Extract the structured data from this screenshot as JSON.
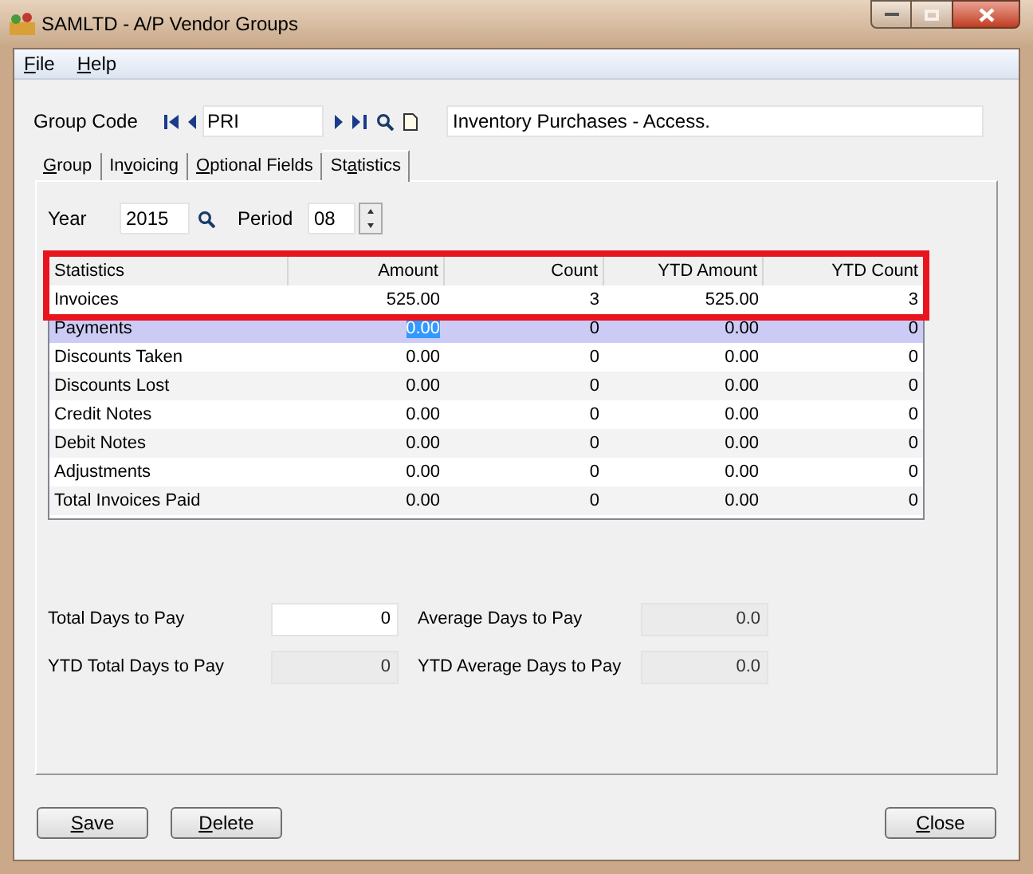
{
  "window": {
    "title": "SAMLTD - A/P Vendor Groups"
  },
  "menu": [
    {
      "key": "F",
      "after": "ile"
    },
    {
      "key": "H",
      "after": "elp"
    }
  ],
  "group_code": {
    "label": "Group Code",
    "value": "PRI",
    "description": "Inventory Purchases - Access."
  },
  "tabs": [
    {
      "key": "G",
      "after": "roup",
      "selected": false
    },
    {
      "before": "In",
      "key": "v",
      "after": "oicing",
      "selected": false
    },
    {
      "key": "O",
      "after": "ptional Fields",
      "selected": false
    },
    {
      "before": "St",
      "key": "a",
      "after": "tistics",
      "selected": true
    }
  ],
  "year": {
    "label": "Year",
    "value": "2015"
  },
  "period": {
    "label": "Period",
    "value": "08"
  },
  "table": {
    "columns": [
      "Statistics",
      "Amount",
      "Count",
      "YTD Amount",
      "YTD Count"
    ],
    "rows": [
      {
        "cells": [
          "Invoices",
          "525.00",
          "3",
          "525.00",
          "3"
        ],
        "selected": false
      },
      {
        "cells": [
          "Payments",
          "0.00",
          "0",
          "0.00",
          "0"
        ],
        "selected": true
      },
      {
        "cells": [
          "Discounts Taken",
          "0.00",
          "0",
          "0.00",
          "0"
        ],
        "selected": false
      },
      {
        "cells": [
          "Discounts Lost",
          "0.00",
          "0",
          "0.00",
          "0"
        ],
        "selected": false
      },
      {
        "cells": [
          "Credit Notes",
          "0.00",
          "0",
          "0.00",
          "0"
        ],
        "selected": false
      },
      {
        "cells": [
          "Debit Notes",
          "0.00",
          "0",
          "0.00",
          "0"
        ],
        "selected": false
      },
      {
        "cells": [
          "Adjustments",
          "0.00",
          "0",
          "0.00",
          "0"
        ],
        "selected": false
      },
      {
        "cells": [
          "Total Invoices Paid",
          "0.00",
          "0",
          "0.00",
          "0"
        ],
        "selected": false
      }
    ]
  },
  "fields": [
    {
      "label": "Total Days to Pay",
      "value": "0",
      "disabled": false
    },
    {
      "label": "Average Days to Pay",
      "value": "0.0",
      "disabled": true
    },
    {
      "label": "YTD Total Days to Pay",
      "value": "0",
      "disabled": true
    },
    {
      "label": "YTD Average Days to Pay",
      "value": "0.0",
      "disabled": true
    }
  ],
  "buttons_left": [
    {
      "key": "S",
      "after": "ave"
    },
    {
      "key": "D",
      "after": "elete"
    }
  ],
  "buttons_right": [
    {
      "key": "C",
      "after": "lose"
    }
  ]
}
